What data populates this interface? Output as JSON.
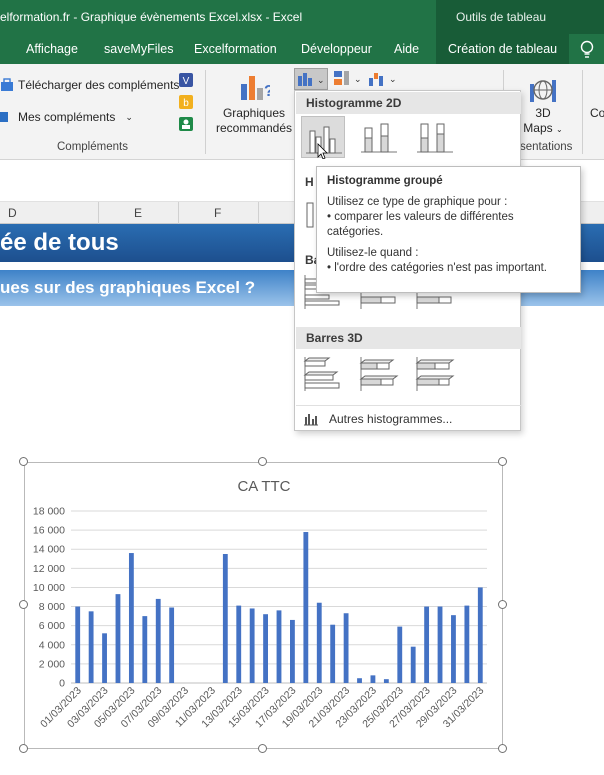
{
  "window": {
    "title": "elformation.fr - Graphique évènements Excel.xlsx  -  Excel",
    "context_group": "Outils de tableau"
  },
  "tabs": [
    "Affichage",
    "saveMyFiles",
    "Excelformation",
    "Développeur",
    "Aide",
    "Création de tableau"
  ],
  "ribbon": {
    "download_addins": "Télécharger des compléments",
    "my_addins": "Mes compléments",
    "addins_group": "Compléments",
    "recommended_charts_1": "Graphiques",
    "recommended_charts_2": "recommandés",
    "maps_3d_1": "3D",
    "maps_3d_2": "Maps",
    "presentations": "sentations",
    "co_cut": "Co"
  },
  "columns": [
    "D",
    "E",
    "F"
  ],
  "sheet": {
    "banner_title": "ée de tous",
    "banner_subtitle": "ues sur des graphiques Excel ?"
  },
  "menu": {
    "section_2d": "Histogramme 2D",
    "section_3d_cut": "H",
    "section_bar_cut": "Ba",
    "section_bar3d": "Barres 3D",
    "more": "Autres histogrammes..."
  },
  "tooltip": {
    "title": "Histogramme groupé",
    "line1": "Utilisez ce type de graphique pour :",
    "line2": "• comparer les valeurs de différentes catégories.",
    "line3": "Utilisez-le quand :",
    "line4": "• l'ordre des catégories n'est pas important."
  },
  "colors": {
    "excel_green": "#217346",
    "context_green": "#185c37",
    "bar_blue": "#4472c4",
    "banner_blue": "#1f5aa0"
  },
  "icons": [
    "store-icon",
    "visio-icon",
    "bing-icon",
    "people-graph-icon",
    "recommended-charts-icon",
    "map-3d-icon",
    "lightbulb-icon",
    "clustered-column-icon",
    "stacked-column-icon",
    "stacked-100-column-icon",
    "clustered-bar-icon",
    "bar-3d-icon",
    "more-charts-icon"
  ],
  "chart_data": {
    "type": "bar",
    "title": "CA TTC",
    "categories": [
      "01/03/2023",
      "02/03/2023",
      "03/03/2023",
      "04/03/2023",
      "05/03/2023",
      "06/03/2023",
      "07/03/2023",
      "08/03/2023",
      "09/03/2023",
      "10/03/2023",
      "11/03/2023",
      "12/03/2023",
      "13/03/2023",
      "14/03/2023",
      "15/03/2023",
      "16/03/2023",
      "17/03/2023",
      "18/03/2023",
      "19/03/2023",
      "20/03/2023",
      "21/03/2023",
      "22/03/2023",
      "23/03/2023",
      "24/03/2023",
      "25/03/2023",
      "26/03/2023",
      "27/03/2023",
      "28/03/2023",
      "29/03/2023",
      "30/03/2023",
      "31/03/2023"
    ],
    "tick_labels": [
      "01/03/2023",
      "03/03/2023",
      "05/03/2023",
      "07/03/2023",
      "09/03/2023",
      "11/03/2023",
      "13/03/2023",
      "15/03/2023",
      "17/03/2023",
      "19/03/2023",
      "21/03/2023",
      "23/03/2023",
      "25/03/2023",
      "27/03/2023",
      "29/03/2023",
      "31/03/2023"
    ],
    "values": [
      8000,
      7500,
      5200,
      9300,
      13600,
      7000,
      8800,
      7900,
      0,
      0,
      0,
      13500,
      8100,
      7800,
      7200,
      7600,
      6600,
      15800,
      8400,
      6100,
      7300,
      500,
      800,
      400,
      5900,
      3800,
      8000,
      8000,
      7100,
      8100,
      10000
    ],
    "ylim": [
      0,
      18000
    ],
    "yticks": [
      "0",
      "2 000",
      "4 000",
      "6 000",
      "8 000",
      "10 000",
      "12 000",
      "14 000",
      "16 000",
      "18 000"
    ],
    "grid": true,
    "legend": "none"
  }
}
